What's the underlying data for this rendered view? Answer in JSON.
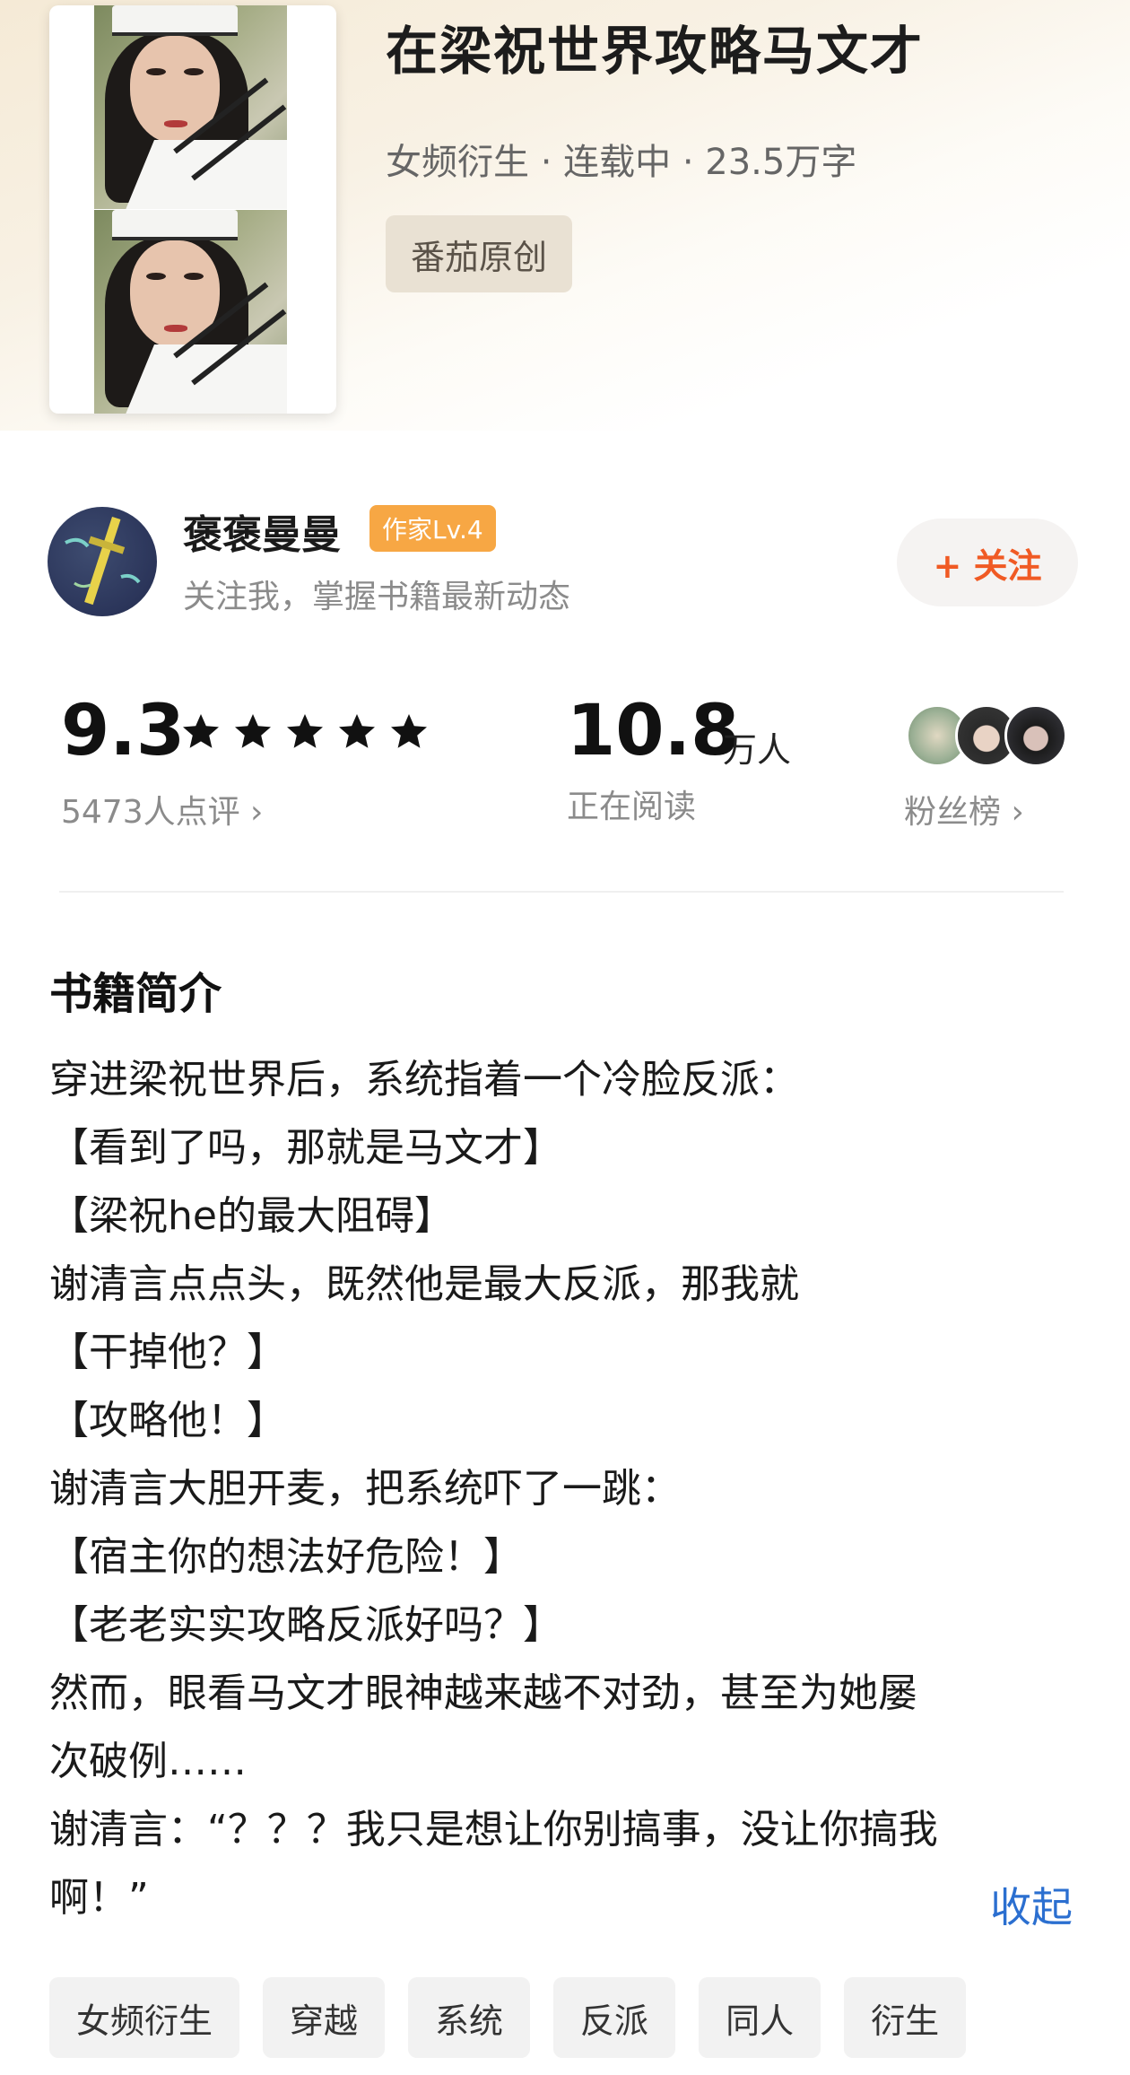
{
  "book": {
    "title": "在梁祝世界攻略马文才",
    "meta": "女频衍生 · 连载中 · 23.5万字",
    "source_tag": "番茄原创"
  },
  "author": {
    "name": "褒褒曼曼",
    "level": "作家Lv.4",
    "description": "关注我，掌握书籍最新动态",
    "follow_label": "+ 关注"
  },
  "stats": {
    "score": "9.3",
    "stars": 5,
    "reviews": "5473人点评 ›",
    "readers_value": "10.8",
    "readers_unit": "万人",
    "readers_label": "正在阅读",
    "fans_label": "粉丝榜 ›"
  },
  "intro": {
    "heading": "书籍简介",
    "lines": [
      "穿进梁祝世界后，系统指着一个冷脸反派：",
      "【看到了吗，那就是马文才】",
      "【梁祝he的最大阻碍】",
      "谢清言点点头，既然他是最大反派，那我就",
      "【干掉他？】",
      "【攻略他！】",
      "谢清言大胆开麦，把系统吓了一跳：",
      "【宿主你的想法好危险！】",
      "【老老实实攻略反派好吗？】",
      "然而，眼看马文才眼神越来越不对劲，甚至为她屡",
      "次破例……",
      "谢清言：“？？？我只是想让你别搞事，没让你搞我",
      "啊！”"
    ],
    "collapse_label": "收起"
  },
  "tags": [
    "女频衍生",
    "穿越",
    "系统",
    "反派",
    "同人",
    "衍生"
  ],
  "colors": {
    "accent_orange": "#f05a24",
    "level_badge": "#f7a744",
    "link_blue": "#2b6fd0"
  }
}
